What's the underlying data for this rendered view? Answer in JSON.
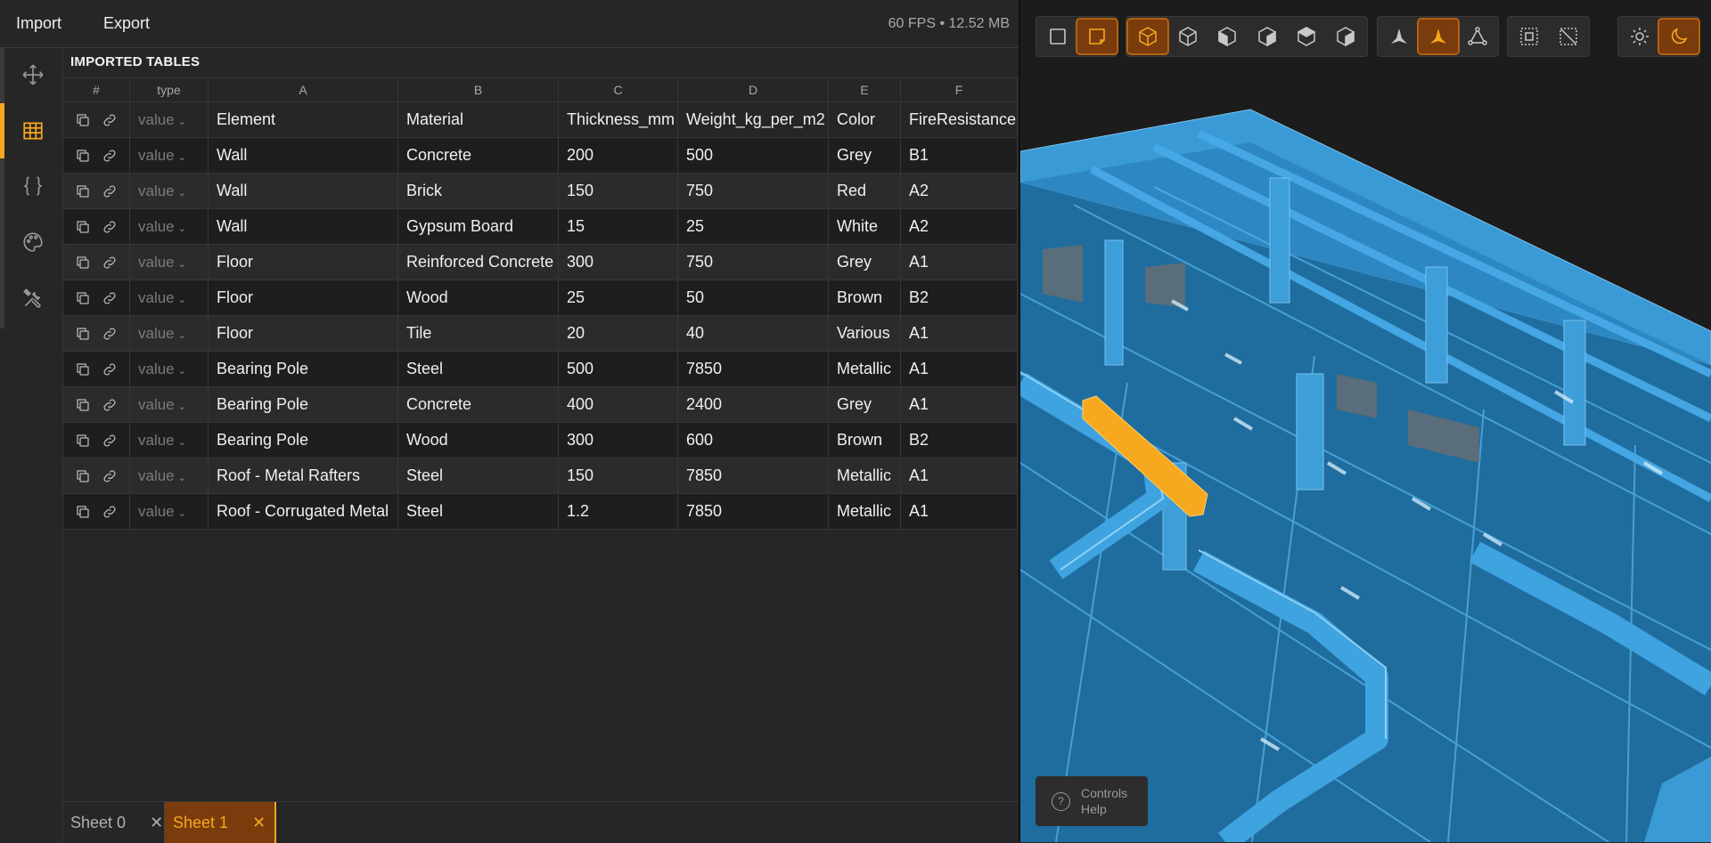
{
  "menu": {
    "import_label": "Import",
    "export_label": "Export",
    "stats": "60 FPS • 12.52 MB"
  },
  "sidebar": {
    "items": [
      {
        "name": "move-icon"
      },
      {
        "name": "table-icon",
        "active": true
      },
      {
        "name": "braces-icon"
      },
      {
        "name": "palette-icon"
      },
      {
        "name": "tools-icon"
      }
    ]
  },
  "tables": {
    "title": "IMPORTED TABLES",
    "columns": [
      "#",
      "type",
      "A",
      "B",
      "C",
      "D",
      "E",
      "F"
    ],
    "type_value": "value",
    "rows": [
      [
        "Element",
        "Material",
        "Thickness_mm",
        "Weight_kg_per_m2",
        "Color",
        "FireResistance"
      ],
      [
        "Wall",
        "Concrete",
        "200",
        "500",
        "Grey",
        "B1"
      ],
      [
        "Wall",
        "Brick",
        "150",
        "750",
        "Red",
        "A2"
      ],
      [
        "Wall",
        "Gypsum Board",
        "15",
        "25",
        "White",
        "A2"
      ],
      [
        "Floor",
        "Reinforced Concrete",
        "300",
        "750",
        "Grey",
        "A1"
      ],
      [
        "Floor",
        "Wood",
        "25",
        "50",
        "Brown",
        "B2"
      ],
      [
        "Floor",
        "Tile",
        "20",
        "40",
        "Various",
        "A1"
      ],
      [
        "Bearing Pole",
        "Steel",
        "500",
        "7850",
        "Metallic",
        "A1"
      ],
      [
        "Bearing Pole",
        "Concrete",
        "400",
        "2400",
        "Grey",
        "A1"
      ],
      [
        "Bearing Pole",
        "Wood",
        "300",
        "600",
        "Brown",
        "B2"
      ],
      [
        "Roof - Metal Rafters",
        "Steel",
        "150",
        "7850",
        "Metallic",
        "A1"
      ],
      [
        "Roof - Corrugated Metal",
        "Steel",
        "1.2",
        "7850",
        "Metallic",
        "A1"
      ]
    ]
  },
  "sheets": {
    "tabs": [
      {
        "label": "Sheet 0",
        "close": "✕",
        "active": false
      },
      {
        "label": "Sheet 1",
        "close": "✕",
        "active": true
      }
    ]
  },
  "viewport": {
    "toolbar_groups": [
      [
        "square-icon",
        "note-icon"
      ],
      [
        "cube-iso-icon",
        "cube-front-icon",
        "cube-left-icon",
        "cube-right-icon",
        "cube-top-icon",
        "cube-bottom-icon"
      ],
      [
        "perspective-icon",
        "perspective-orange-icon",
        "orthographic-icon"
      ],
      [
        "select-box-icon",
        "deselect-box-icon"
      ],
      [
        "sun-icon",
        "moon-icon"
      ]
    ],
    "active_tools": [
      "note-icon",
      "cube-iso-icon",
      "perspective-orange-icon",
      "moon-icon"
    ],
    "help": {
      "line1": "Controls",
      "line2": "Help"
    }
  },
  "colors": {
    "accent": "#f6a81e",
    "accent_bg": "#7a3c0c",
    "model_blue": "#2f8ccc"
  }
}
